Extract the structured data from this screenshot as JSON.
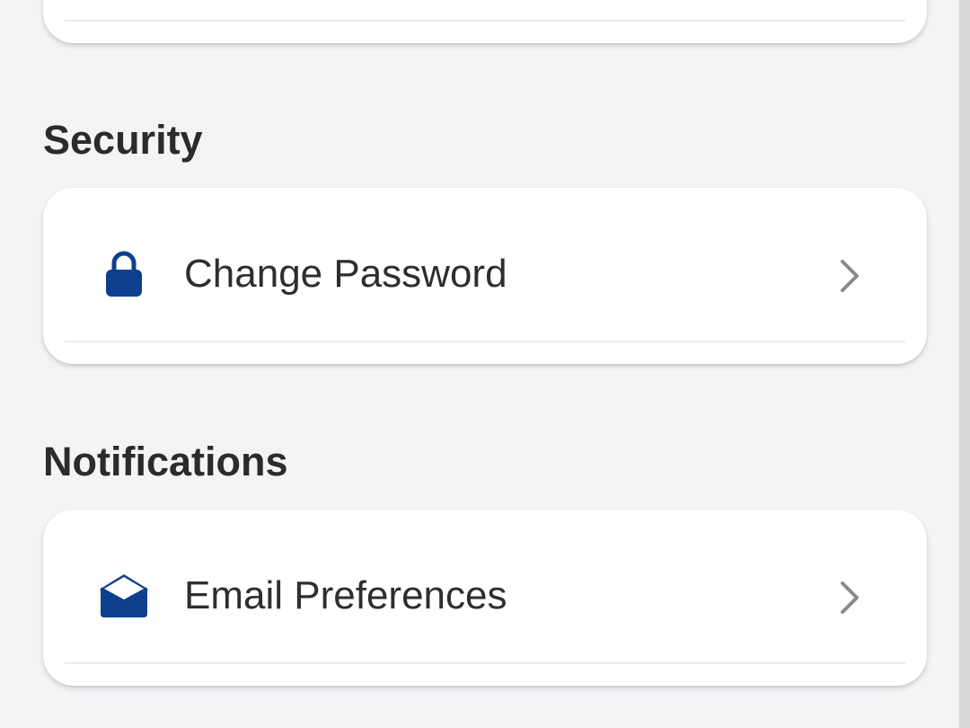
{
  "sections": [
    {
      "title": "Security",
      "items": [
        {
          "label": "Change Password",
          "icon": "lock-icon"
        }
      ]
    },
    {
      "title": "Notifications",
      "items": [
        {
          "label": "Email Preferences",
          "icon": "envelope-open-icon"
        }
      ]
    }
  ],
  "colors": {
    "accent": "#0d3f8f",
    "chevron": "#8a8a8a",
    "background": "#f3f4f6",
    "card": "#ffffff"
  }
}
